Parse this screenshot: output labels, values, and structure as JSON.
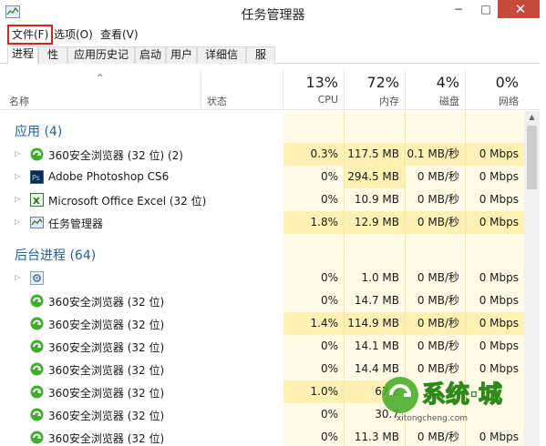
{
  "window": {
    "title": "任务管理器",
    "controls": {
      "minimize": "−",
      "maximize": "□",
      "close": "✕"
    }
  },
  "menu": {
    "file": "文件(F)",
    "options": "选项(O)",
    "view": "查看(V)"
  },
  "tabs": [
    "进程",
    "性能",
    "应用历史记录",
    "启动",
    "用户",
    "详细信息",
    "服务"
  ],
  "active_tab": "进程",
  "columns": {
    "name": "名称",
    "status": "状态",
    "cpu": {
      "pct": "13%",
      "label": "CPU"
    },
    "memory": {
      "pct": "72%",
      "label": "内存"
    },
    "disk": {
      "pct": "4%",
      "label": "磁盘"
    },
    "network": {
      "pct": "0%",
      "label": "网络"
    }
  },
  "groups": {
    "apps": {
      "title": "应用 (4)",
      "rows": [
        {
          "name": "360安全浏览器 (32 位) (2)",
          "icon": "360-browser-icon",
          "cpu": "0.3%",
          "mem": "117.5 MB",
          "disk": "0.1 MB/秒",
          "net": "0 Mbps",
          "hi": [
            "cpu",
            "mem",
            "disk",
            "net"
          ]
        },
        {
          "name": "Adobe Photoshop CS6",
          "icon": "photoshop-icon",
          "cpu": "0%",
          "mem": "294.5 MB",
          "disk": "0 MB/秒",
          "net": "0 Mbps",
          "hi": [
            "mem"
          ]
        },
        {
          "name": "Microsoft Office Excel (32 位)",
          "icon": "excel-icon",
          "cpu": "0%",
          "mem": "10.9 MB",
          "disk": "0 MB/秒",
          "net": "0 Mbps",
          "hi": []
        },
        {
          "name": "任务管理器",
          "icon": "task-manager-icon",
          "cpu": "1.8%",
          "mem": "12.9 MB",
          "disk": "0 MB/秒",
          "net": "0 Mbps",
          "hi": [
            "cpu",
            "mem",
            "disk",
            "net"
          ]
        }
      ]
    },
    "background": {
      "title": "后台进程 (64)",
      "rows": [
        {
          "name": "",
          "icon": "gear-icon",
          "cpu": "0%",
          "mem": "1.0 MB",
          "disk": "0 MB/秒",
          "net": "0 Mbps",
          "hi": []
        },
        {
          "name": "360安全浏览器 (32 位)",
          "icon": "360-browser-icon",
          "cpu": "0%",
          "mem": "14.7 MB",
          "disk": "0 MB/秒",
          "net": "0 Mbps",
          "hi": []
        },
        {
          "name": "360安全浏览器 (32 位)",
          "icon": "360-browser-icon",
          "cpu": "1.4%",
          "mem": "114.9 MB",
          "disk": "0 MB/秒",
          "net": "0 Mbps",
          "hi": [
            "cpu",
            "mem",
            "disk",
            "net"
          ]
        },
        {
          "name": "360安全浏览器 (32 位)",
          "icon": "360-browser-icon",
          "cpu": "0%",
          "mem": "14.1 MB",
          "disk": "0 MB/秒",
          "net": "0 Mbps",
          "hi": []
        },
        {
          "name": "360安全浏览器 (32 位)",
          "icon": "360-browser-icon",
          "cpu": "0%",
          "mem": "14.4 MB",
          "disk": "0 MB/秒",
          "net": "0 Mbps",
          "hi": []
        },
        {
          "name": "360安全浏览器 (32 位)",
          "icon": "360-browser-icon",
          "cpu": "1.0%",
          "mem": "67.2",
          "disk": "",
          "net": "",
          "hi": [
            "cpu",
            "mem"
          ]
        },
        {
          "name": "360安全浏览器 (32 位)",
          "icon": "360-browser-icon",
          "cpu": "0%",
          "mem": "30.7",
          "disk": "",
          "net": "",
          "hi": []
        },
        {
          "name": "360安全浏览器 (32 位)",
          "icon": "360-browser-icon",
          "cpu": "0%",
          "mem": "11.3 MB",
          "disk": "0 MB/秒",
          "net": "0 Mbps",
          "hi": []
        }
      ]
    }
  },
  "watermark": {
    "logo_text": "系统·城",
    "url": "xitongcheng.com"
  },
  "colors": {
    "group_title": "#1e5fb0",
    "highlight_cell": "#fff0b3",
    "column_bg": "#fffbe6",
    "file_menu_outline": "#e0201e",
    "close_button": "#c7493a"
  }
}
